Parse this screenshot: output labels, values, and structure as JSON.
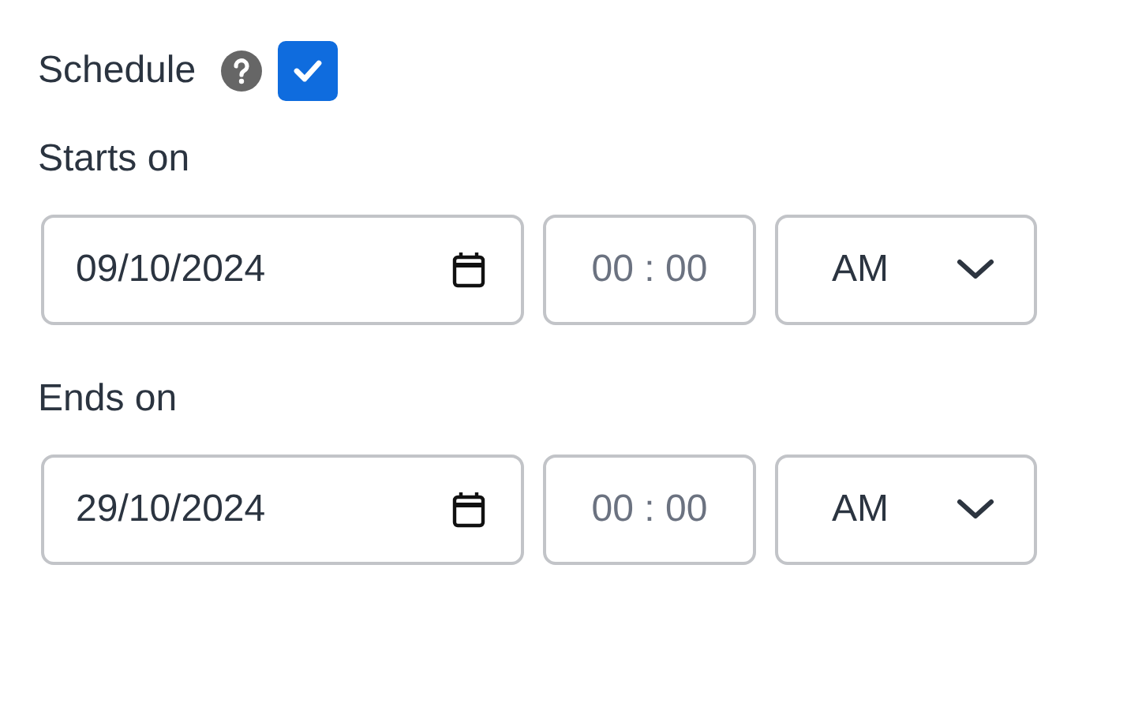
{
  "schedule": {
    "label": "Schedule",
    "checked": true
  },
  "ranges": [
    {
      "label": "Starts on",
      "date": "09/10/2024",
      "time_placeholder": "00 : 00",
      "period": "AM"
    },
    {
      "label": "Ends on",
      "date": "29/10/2024",
      "time_placeholder": "00 : 00",
      "period": "AM"
    }
  ]
}
